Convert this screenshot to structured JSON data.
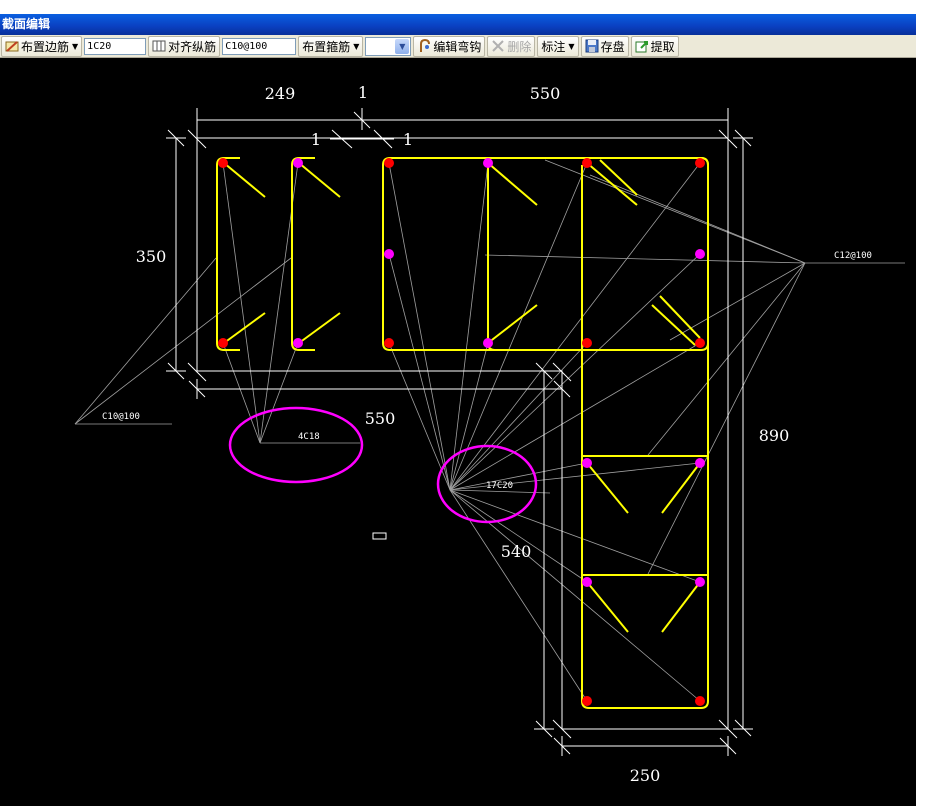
{
  "window": {
    "title": "截面编辑"
  },
  "toolbar": {
    "place_edge_bar": "布置边筋",
    "edge_bar_value": "1C20",
    "align_bars": "对齐纵筋",
    "stirrup_value": "C10@100",
    "place_stirrup": "布置箍筋",
    "edit_hook": "编辑弯钩",
    "delete": "删除",
    "annotate": "标注",
    "save": "存盘",
    "extract": "提取"
  },
  "drawing": {
    "dims": {
      "top_left": "249",
      "top_mid": "1",
      "top_right": "550",
      "section_left": "1",
      "section_right": "1",
      "left": "350",
      "right": "890",
      "mid": "550",
      "lower": "540",
      "bottom": "250"
    },
    "labels": {
      "stirrup_right": "C12@100",
      "stirrup_left": "C10@100",
      "bars_4": "4C18",
      "bars_17": "17C20"
    },
    "colors": {
      "stirrup": "#ffff00",
      "corner_bar": "#ff0000",
      "mid_bar": "#ff00ff",
      "outline": "#ffffff",
      "leader": "#a0a0a0",
      "callout": "#ff00ff"
    }
  }
}
